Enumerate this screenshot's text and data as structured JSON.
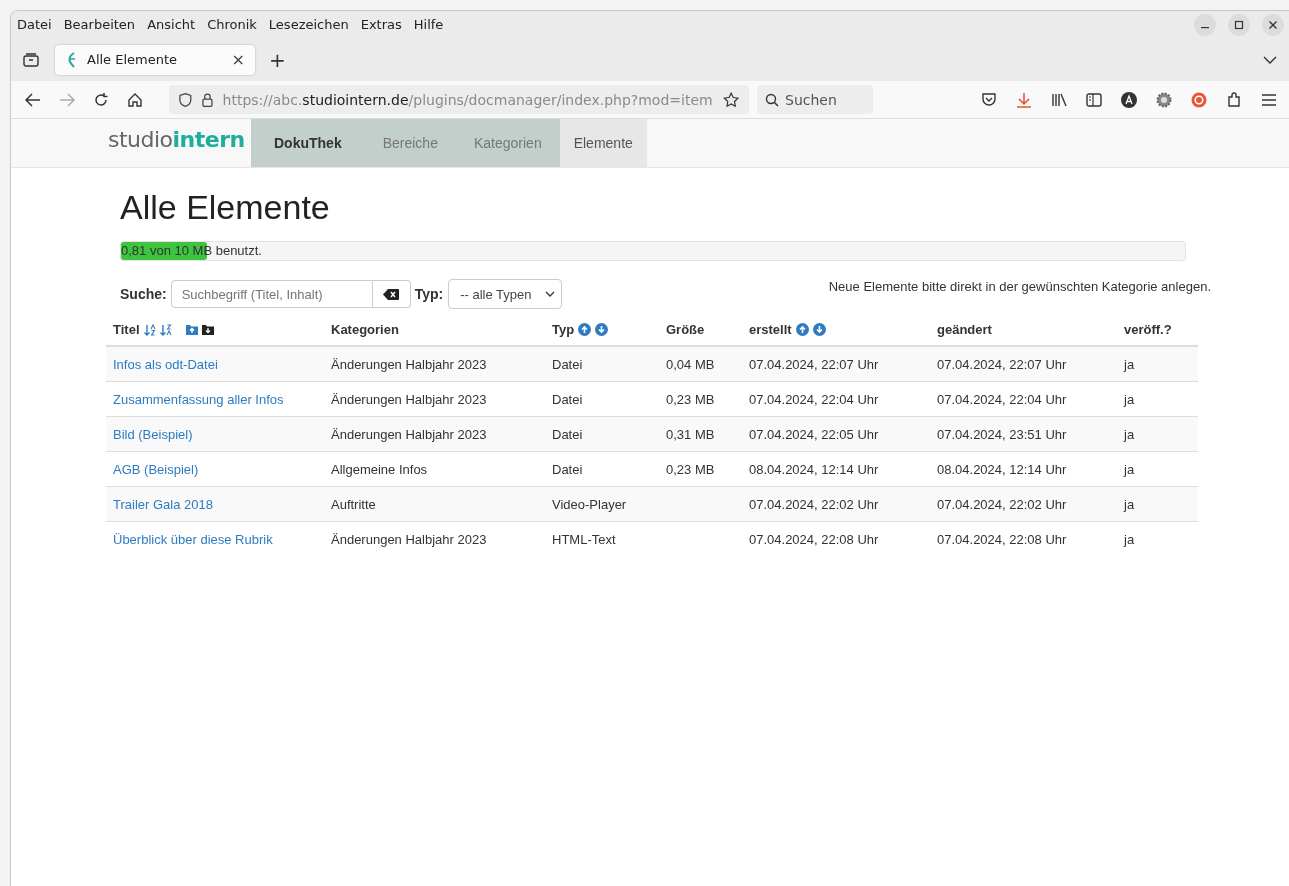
{
  "menu": [
    "Datei",
    "Bearbeiten",
    "Ansicht",
    "Chronik",
    "Lesezeichen",
    "Extras",
    "Hilfe"
  ],
  "tab": {
    "title": "Alle Elemente",
    "close": "×",
    "new": "+"
  },
  "address": {
    "prefix": "https://abc.",
    "domain": "studiointern.de",
    "path": "/plugins/docmanager/index.php?mod=item"
  },
  "browser_search": {
    "placeholder": "Suchen"
  },
  "logo": {
    "part1": "studio",
    "part2": "intern"
  },
  "nav": [
    {
      "label": "DokuThek",
      "kind": "brand",
      "selected": false
    },
    {
      "label": "Bereiche",
      "kind": "link",
      "selected": false
    },
    {
      "label": "Kategorien",
      "kind": "link",
      "selected": false
    },
    {
      "label": "Elemente",
      "kind": "link",
      "selected": true
    }
  ],
  "heading": "Alle Elemente",
  "quota": {
    "label": "0,81 von 10 MB benutzt.",
    "level": 0.081
  },
  "search": {
    "label": "Suche:",
    "placeholder": "Suchbegriff (Titel, Inhalt)"
  },
  "type_filter": {
    "label": "Typ:",
    "value": "-- alle Typen"
  },
  "hint": "Neue Elemente bitte direkt in der gewünschten Kategorie anlegen.",
  "columns": [
    {
      "label": "Titel",
      "kind": "title"
    },
    {
      "label": "Kategorien",
      "kind": "plain"
    },
    {
      "label": "Typ",
      "kind": "sort"
    },
    {
      "label": "Größe",
      "kind": "plain"
    },
    {
      "label": "erstellt",
      "kind": "sort"
    },
    {
      "label": "geändert",
      "kind": "plain"
    },
    {
      "label": "veröff.?",
      "kind": "plain"
    }
  ],
  "rows": [
    [
      "Infos als odt-Datei",
      "Änderungen Halbjahr 2023",
      "Datei",
      "0,04 MB",
      "07.04.2024, 22:07 Uhr",
      "07.04.2024, 22:07 Uhr",
      "ja"
    ],
    [
      "Zusammenfassung aller Infos",
      "Änderungen Halbjahr 2023",
      "Datei",
      "0,23 MB",
      "07.04.2024, 22:04 Uhr",
      "07.04.2024, 22:04 Uhr",
      "ja"
    ],
    [
      "Bild (Beispiel)",
      "Änderungen Halbjahr 2023",
      "Datei",
      "0,31 MB",
      "07.04.2024, 22:05 Uhr",
      "07.04.2024, 23:51 Uhr",
      "ja"
    ],
    [
      "AGB (Beispiel)",
      "Allgemeine Infos",
      "Datei",
      "0,23 MB",
      "08.04.2024, 12:14 Uhr",
      "08.04.2024, 12:14 Uhr",
      "ja"
    ],
    [
      "Trailer Gala 2018",
      "Auftritte",
      "Video-Player",
      "",
      "07.04.2024, 22:02 Uhr",
      "07.04.2024, 22:02 Uhr",
      "ja"
    ],
    [
      "Überblick über diese Rubrik",
      "Änderungen Halbjahr 2023",
      "HTML-Text",
      "",
      "07.04.2024, 22:08 Uhr",
      "07.04.2024, 22:08 Uhr",
      "ja"
    ]
  ]
}
